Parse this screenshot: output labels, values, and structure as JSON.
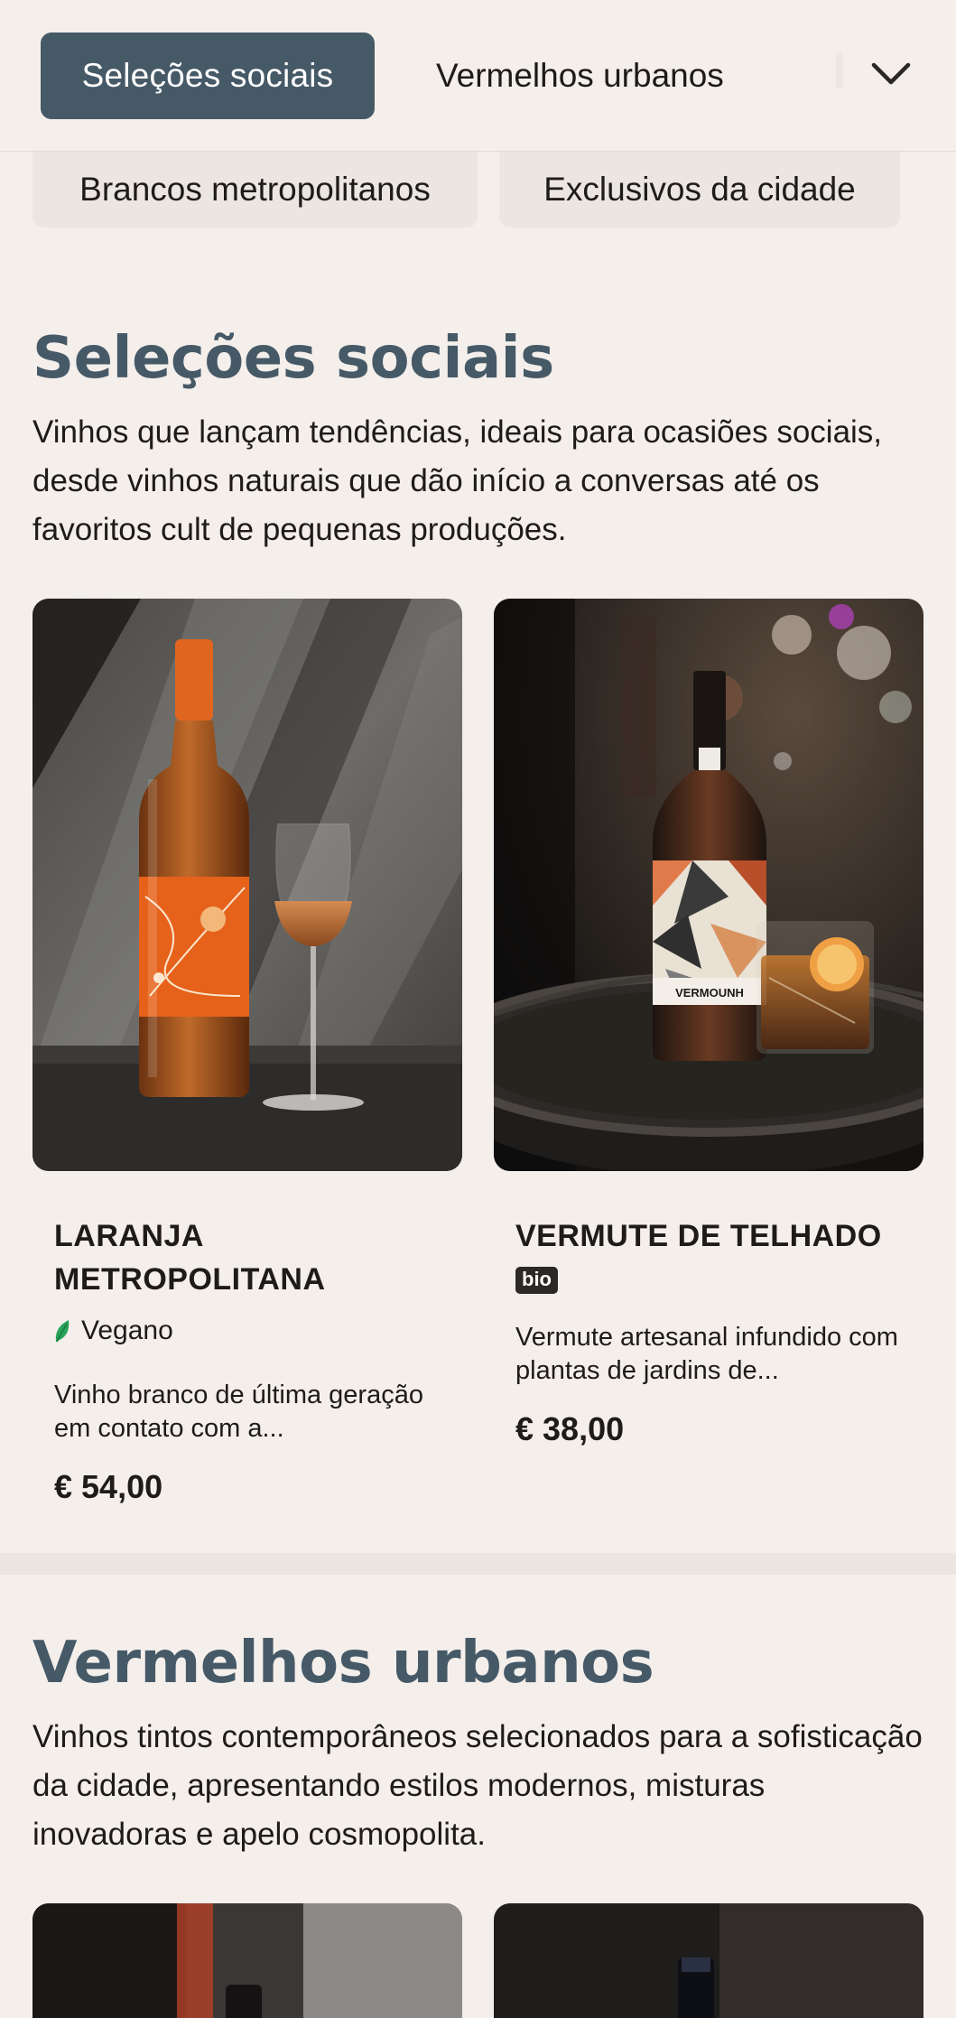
{
  "nav": {
    "tabs": [
      {
        "label": "Seleções sociais",
        "active": true
      },
      {
        "label": "Vermelhos urbanos",
        "active": false
      },
      {
        "label": "Brancos metropolitanos",
        "active": false
      },
      {
        "label": "Exclusivos da cidade",
        "active": false
      }
    ],
    "expand_icon": "chevron-down-icon",
    "active_color": "#465967"
  },
  "sections": [
    {
      "title": "Seleções sociais",
      "description": "Vinhos que lançam tendências, ideais para ocasiões sociais, desde vinhos naturais que dão início a conversas até os favoritos cult de pequenas produções.",
      "products": [
        {
          "name": "LARANJA METROPOLITANA",
          "tag": "Vegano",
          "tag_icon": "leaf-icon",
          "description": "Vinho branco de última geração em contato com a...",
          "price": "€ 54,00"
        },
        {
          "name": "VERMUTE DE TELHADO",
          "badge": "bio",
          "description": "Vermute artesanal infundido com plantas de jardins de...",
          "price": "€ 38,00",
          "label_text": "VERMOUNH"
        }
      ]
    },
    {
      "title": "Vermelhos urbanos",
      "description": "Vinhos tintos contemporâneos selecionados para a sofisticação da cidade, apresentando estilos modernos, misturas inovadoras e apelo cosmopolita."
    }
  ],
  "colors": {
    "background": "#f4efeb",
    "title": "#465967",
    "vegan_leaf": "#27a35a"
  }
}
